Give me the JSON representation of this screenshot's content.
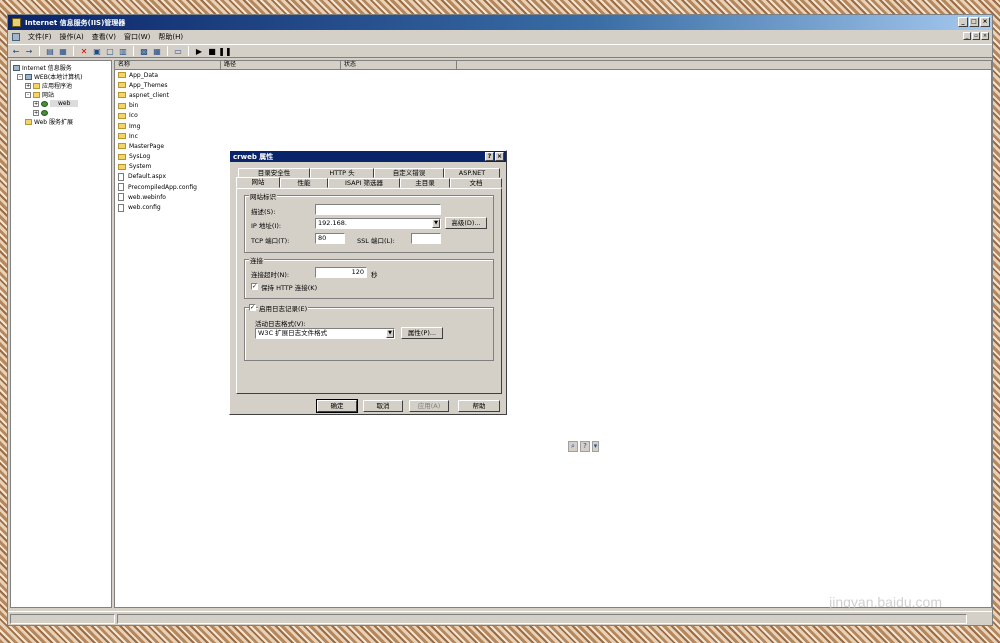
{
  "window": {
    "title": "Internet 信息服务(IIS)管理器"
  },
  "menu": [
    "文件(F)",
    "操作(A)",
    "查看(V)",
    "窗口(W)",
    "帮助(H)"
  ],
  "tree": {
    "root": "Internet 信息服务",
    "computer": "WEB(本地计算机)",
    "app_pools": "应用程序池",
    "websites": "网站",
    "site1": "web",
    "site2": "",
    "web_ext": "Web 服务扩展"
  },
  "list": {
    "columns": [
      "名称",
      "路径",
      "状态"
    ],
    "items": [
      {
        "name": "App_Data",
        "icon": "folder-icon"
      },
      {
        "name": "App_Themes",
        "icon": "folder-icon"
      },
      {
        "name": "aspnet_client",
        "icon": "folder-icon"
      },
      {
        "name": "bin",
        "icon": "folder-icon"
      },
      {
        "name": "Ico",
        "icon": "folder-icon"
      },
      {
        "name": "Img",
        "icon": "folder-icon"
      },
      {
        "name": "Inc",
        "icon": "folder-icon"
      },
      {
        "name": "MasterPage",
        "icon": "folder-icon"
      },
      {
        "name": "SysLog",
        "icon": "folder-icon"
      },
      {
        "name": "System",
        "icon": "folder-icon"
      },
      {
        "name": "Default.aspx",
        "icon": "document-icon"
      },
      {
        "name": "PrecompiledApp.config",
        "icon": "document-icon"
      },
      {
        "name": "web.webinfo",
        "icon": "document-icon"
      },
      {
        "name": "web.config",
        "icon": "document-icon"
      }
    ]
  },
  "dialog": {
    "title": "crweb 属性",
    "tabs_back": [
      "目录安全性",
      "HTTP 头",
      "自定义错误",
      "ASP.NET"
    ],
    "tabs_front": [
      "网站",
      "性能",
      "ISAPI 筛选器",
      "主目录",
      "文档"
    ],
    "identity_group": "网站标识",
    "desc_label": "描述(S):",
    "desc_value": "",
    "ip_label": "IP 地址(I):",
    "ip_value": "192.168.",
    "advanced_btn": "高级(D)...",
    "tcp_label": "TCP 端口(T):",
    "tcp_value": "80",
    "ssl_label": "SSL 端口(L):",
    "ssl_value": "",
    "conn_group": "连接",
    "timeout_label": "连接超时(N):",
    "timeout_value": "120",
    "timeout_unit": "秒",
    "keepalive_label": "保持 HTTP 连接(K)",
    "logging_label": "启用日志记录(E)",
    "logformat_label": "活动日志格式(V):",
    "logformat_value": "W3C 扩展日志文件格式",
    "props_btn": "属性(P)...",
    "ok": "确定",
    "cancel": "取消",
    "apply": "应用(A)",
    "help": "帮助"
  },
  "watermark": {
    "brand": "Baidu经验",
    "url": "jingyan.baidu.com"
  }
}
